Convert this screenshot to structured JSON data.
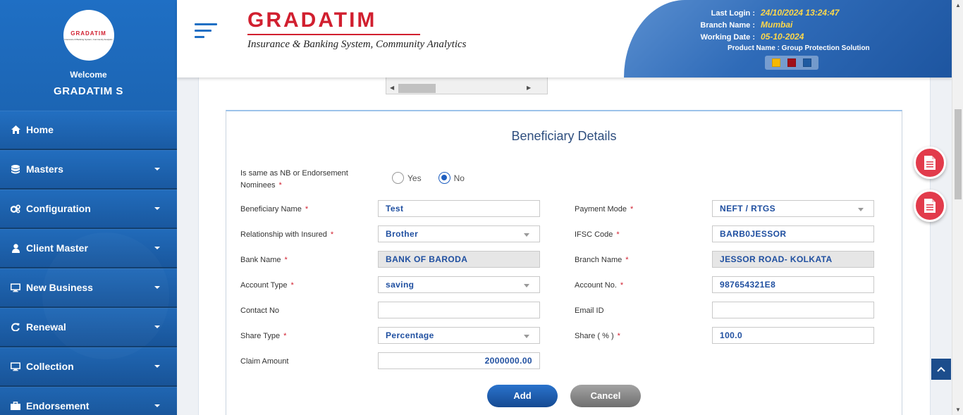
{
  "sidebar": {
    "welcome": "Welcome",
    "username": "GRADATIM S",
    "avatar_logo": "GRADATIM",
    "avatar_tagline": "Insurance & Banking System, Community Analytics",
    "items": [
      {
        "label": "Home",
        "icon": "home-icon"
      },
      {
        "label": "Masters",
        "icon": "database-icon"
      },
      {
        "label": "Configuration",
        "icon": "cogs-icon"
      },
      {
        "label": "Client Master",
        "icon": "user-icon"
      },
      {
        "label": "New Business",
        "icon": "monitor-icon"
      },
      {
        "label": "Renewal",
        "icon": "refresh-icon"
      },
      {
        "label": "Collection",
        "icon": "monitor-icon"
      },
      {
        "label": "Endorsement",
        "icon": "briefcase-icon"
      }
    ]
  },
  "header": {
    "logo_text": "GRADATIM",
    "logo_tagline": "Insurance & Banking System, Community Analytics",
    "last_login_label": "Last Login :",
    "last_login_value": "24/10/2024 13:24:47",
    "branch_label": "Branch Name :",
    "branch_value": "Mumbai",
    "working_date_label": "Working Date :",
    "working_date_value": "05-10-2024",
    "product": "Product Name : Group Protection Solution",
    "theme_colors": [
      "#f5b800",
      "#a01018",
      "#1f5aa0"
    ]
  },
  "form": {
    "title": "Beneficiary Details",
    "same_as_nb_label_line1": "Is same as NB or Endorsement",
    "same_as_nb_label_line2": "Nominees",
    "yes_label": "Yes",
    "no_label": "No",
    "selected": "No",
    "beneficiary_name_label": "Beneficiary Name",
    "beneficiary_name_value": "Test",
    "relationship_label": "Relationship with Insured",
    "relationship_value": "Brother",
    "bank_name_label": "Bank Name",
    "bank_name_value": "BANK OF BARODA",
    "account_type_label": "Account Type",
    "account_type_value": "saving",
    "contact_label": "Contact No",
    "contact_value": "",
    "share_type_label": "Share Type",
    "share_type_value": "Percentage",
    "claim_amount_label": "Claim Amount",
    "claim_amount_value": "2000000.00",
    "payment_mode_label": "Payment Mode",
    "payment_mode_value": "NEFT / RTGS",
    "ifsc_label": "IFSC Code",
    "ifsc_value": "BARB0JESSOR",
    "branch_name_label": "Branch Name",
    "branch_name_value": "JESSOR ROAD- KOLKATA",
    "account_no_label": "Account No.",
    "account_no_value": "987654321E8",
    "email_label": "Email ID",
    "email_value": "",
    "share_pct_label": "Share ( % )",
    "share_pct_value": "100.0",
    "required_mark": "*",
    "add_label": "Add",
    "cancel_label": "Cancel"
  },
  "accent": "#1f6fc4",
  "danger": "#e23b4b"
}
